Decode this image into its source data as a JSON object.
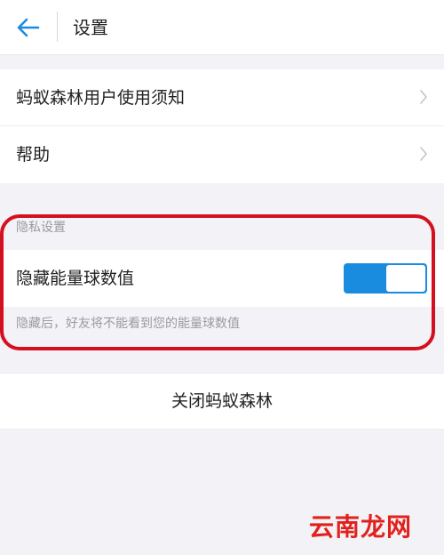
{
  "header": {
    "title": "设置",
    "back_icon": "arrow-left-icon"
  },
  "menu": {
    "items": [
      {
        "label": "蚂蚁森林用户使用须知",
        "icon": "chevron-right-icon"
      },
      {
        "label": "帮助",
        "icon": "chevron-right-icon"
      }
    ]
  },
  "privacy": {
    "section_title": "隐私设置",
    "hide_energy_label": "隐藏能量球数值",
    "hide_energy_on": true,
    "hint": "隐藏后，好友将不能看到您的能量球数值"
  },
  "close": {
    "label": "关闭蚂蚁森林"
  },
  "watermark": "云南龙网",
  "colors": {
    "accent": "#1a8cdf",
    "highlight": "#d5101e",
    "background": "#f2f2f7"
  }
}
